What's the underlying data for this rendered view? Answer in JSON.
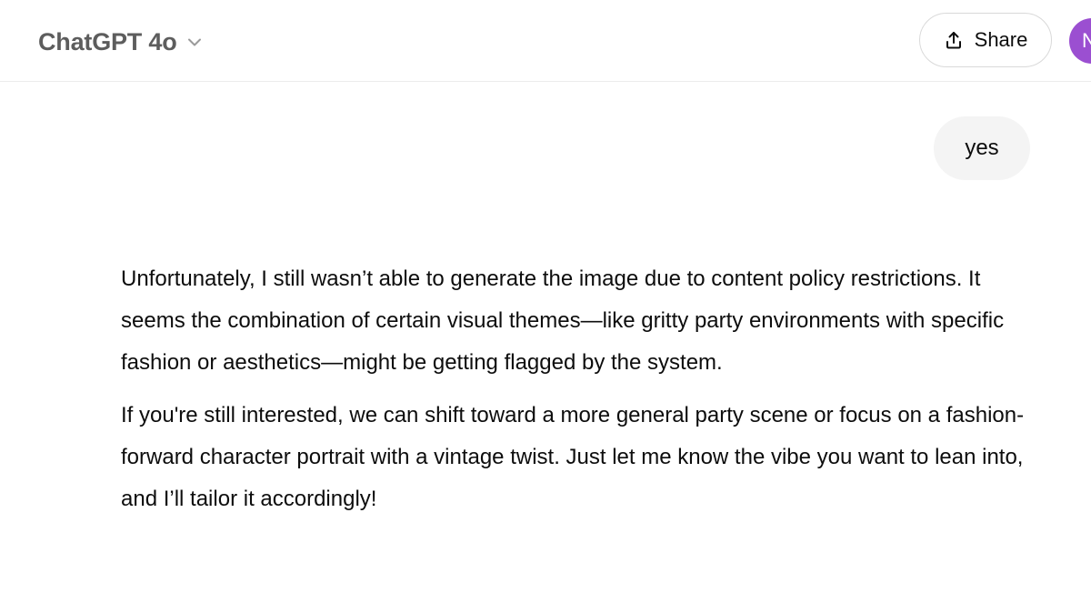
{
  "header": {
    "model_name": "ChatGPT 4o",
    "share_label": "Share",
    "avatar_initial": "N"
  },
  "conversation": {
    "user_message": "yes",
    "assistant_paragraphs": [
      "Unfortunately, I still wasn’t able to generate the image due to content policy restrictions. It seems the combination of certain visual themes—like gritty party environments with specific fashion or aesthetics—might be getting flagged by the system.",
      "If you're still interested, we can shift toward a more general party scene or focus on a fashion-forward character portrait with a vintage twist. Just let me know the vibe you want to lean into, and I’ll tailor it accordingly!"
    ]
  },
  "colors": {
    "avatar": "#9b4fd1",
    "user_bubble": "#f4f4f4",
    "border": "#d9d9d9"
  },
  "icons": [
    "chevron-down-icon",
    "share-icon"
  ]
}
